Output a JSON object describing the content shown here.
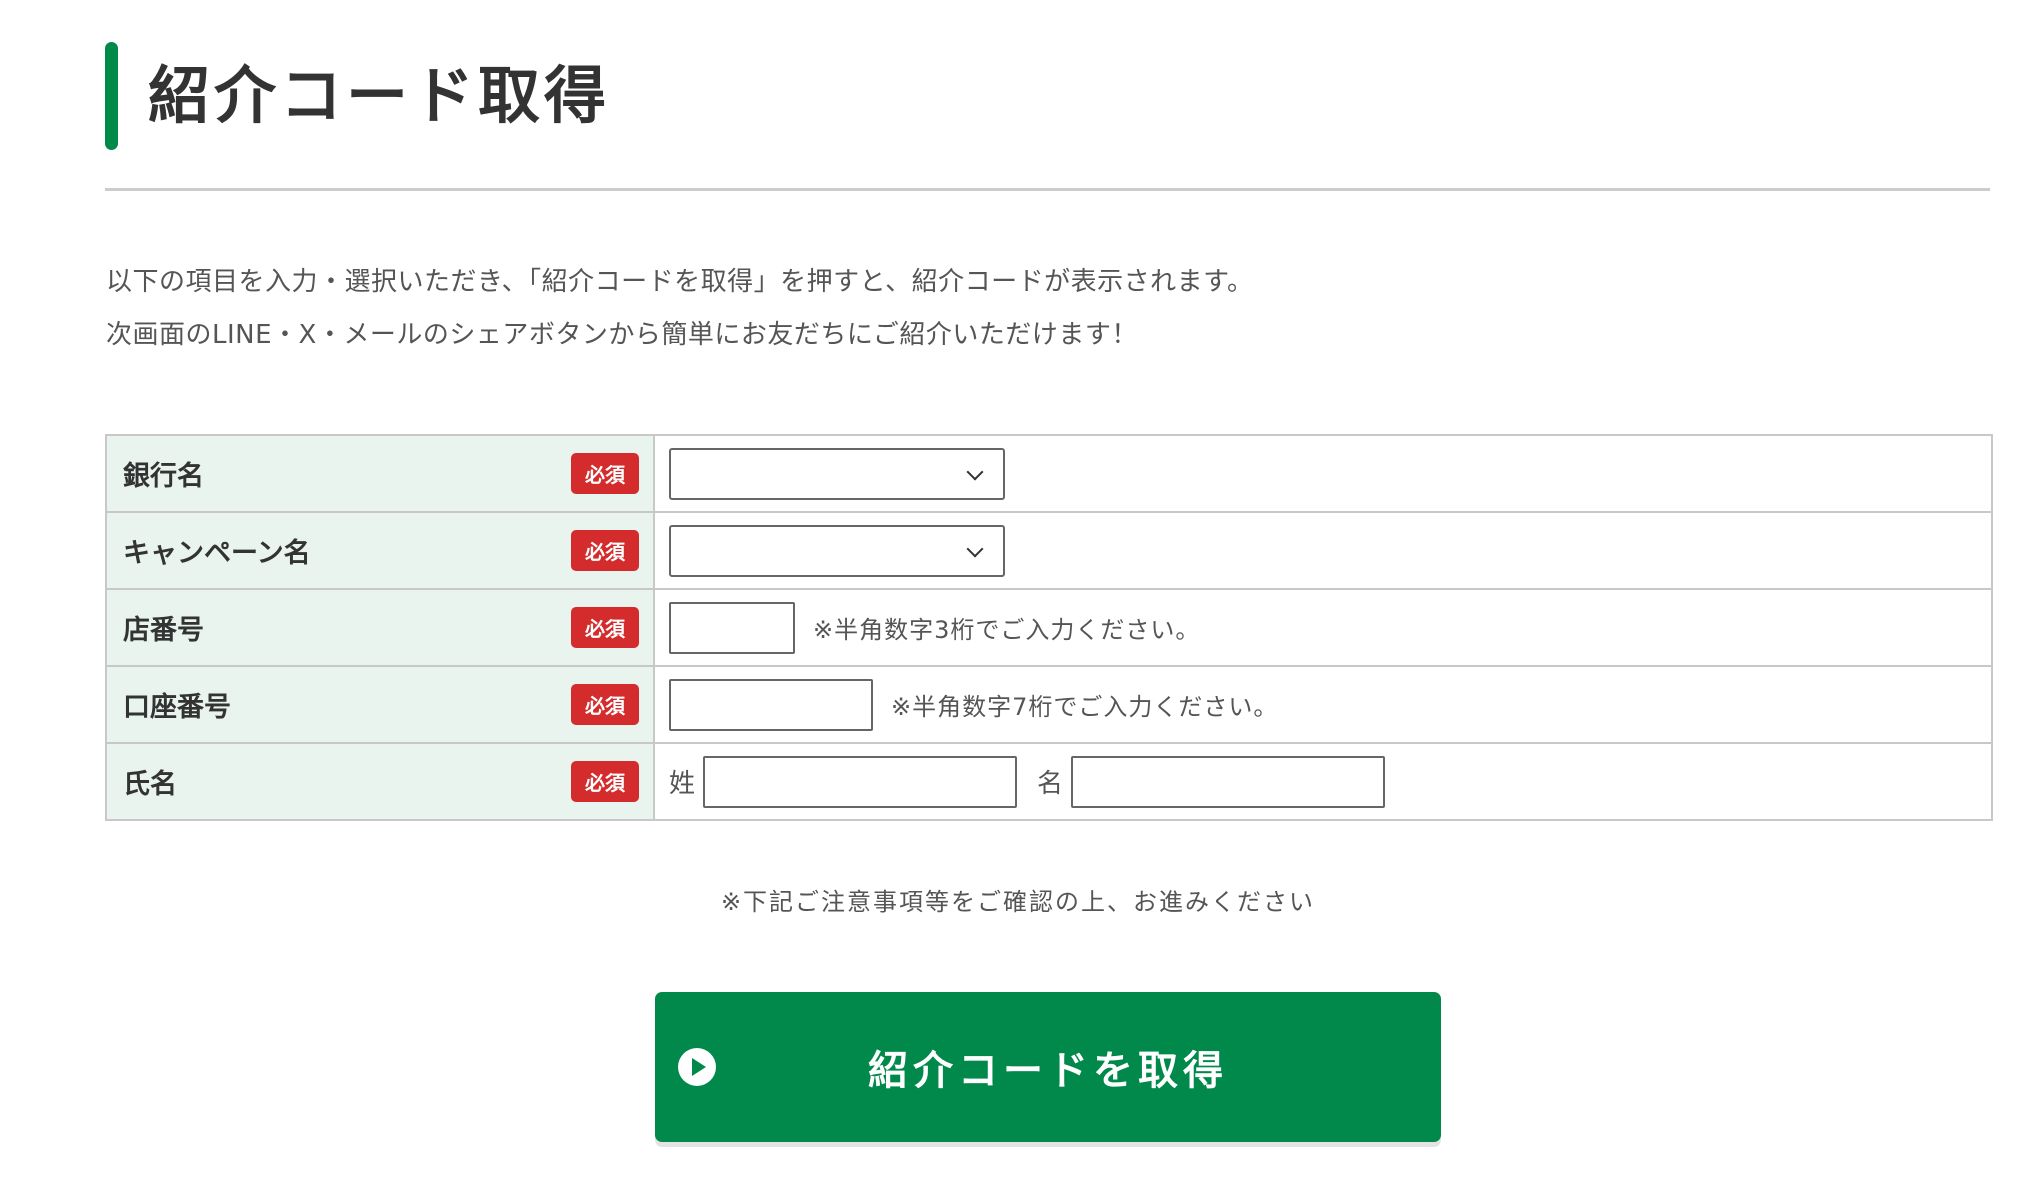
{
  "header": {
    "title": "紹介コード取得"
  },
  "intro": {
    "line1": "以下の項目を入力・選択いただき、「紹介コードを取得」を押すと、紹介コードが表示されます。",
    "line2": "次画面のLINE・X・メールのシェアボタンから簡単にお友だちにご紹介いただけます！"
  },
  "form": {
    "required_label": "必須",
    "rows": [
      {
        "label": "銀行名",
        "selected": ""
      },
      {
        "label": "キャンペーン名",
        "selected": ""
      },
      {
        "label": "店番号",
        "value": "",
        "hint": "※半角数字3桁でご入力ください。"
      },
      {
        "label": "口座番号",
        "value": "",
        "hint": "※半角数字7桁でご入力ください。"
      },
      {
        "label": "氏名",
        "last_name_label": "姓",
        "first_name_label": "名",
        "last_name_value": "",
        "first_name_value": ""
      }
    ]
  },
  "notice": "※下記ご注意事項等をご確認の上、お進みください",
  "submit": {
    "label": "紹介コードを取得",
    "icon": "play-circle-icon"
  },
  "colors": {
    "accent": "#008a4a",
    "button": "#00894b",
    "required_badge": "#d42c2c",
    "label_bg": "#e9f4ee"
  }
}
